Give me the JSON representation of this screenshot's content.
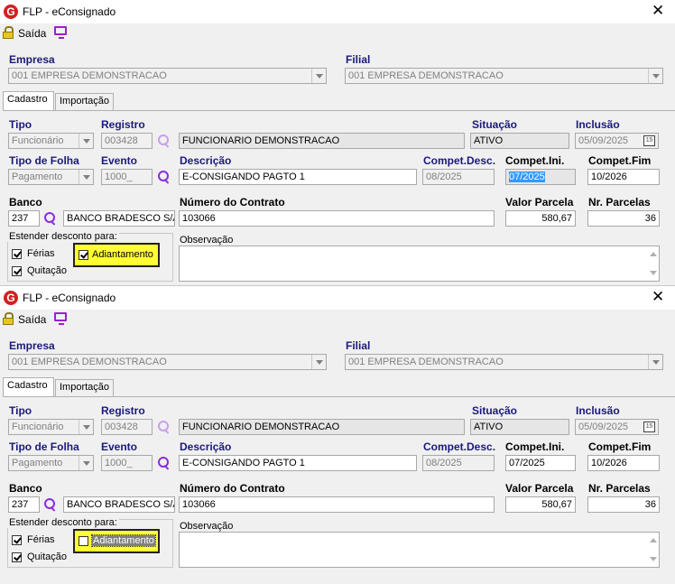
{
  "screens": [
    {
      "window_title": "FLP - eConsignado",
      "toolbar": {
        "exit_label": "Saída"
      },
      "empresa": {
        "label": "Empresa",
        "value": "001 EMPRESA DEMONSTRACAO"
      },
      "filial": {
        "label": "Filial",
        "value": "001 EMPRESA DEMONSTRACAO"
      },
      "tabs": [
        "Cadastro",
        "Importação"
      ],
      "tipo": {
        "label": "Tipo",
        "value": "Funcionário"
      },
      "registro": {
        "label": "Registro",
        "value": "003428",
        "name": "FUNCIONARIO DEMONSTRACAO"
      },
      "situacao": {
        "label": "Situação",
        "value": "ATIVO"
      },
      "inclusao": {
        "label": "Inclusão",
        "value": "05/09/2025",
        "calendar_day": "15"
      },
      "tipo_folha": {
        "label": "Tipo de Folha",
        "value": "Pagamento"
      },
      "evento": {
        "label": "Evento",
        "value": "1000_"
      },
      "descricao": {
        "label": "Descrição",
        "value": "E-CONSIGANDO PAGTO 1"
      },
      "compet_desc": {
        "label": "Compet.Desc.",
        "value": "08/2025"
      },
      "compet_ini": {
        "label": "Compet.Ini.",
        "value": "07/2025"
      },
      "compet_fim": {
        "label": "Compet.Fim",
        "value": "10/2026"
      },
      "banco": {
        "label": "Banco",
        "code": "237",
        "name": "BANCO BRADESCO S/A"
      },
      "contrato": {
        "label": "Número do Contrato",
        "value": "103066"
      },
      "valor_parcela": {
        "label": "Valor Parcela",
        "value": "580,67"
      },
      "nr_parcelas": {
        "label": "Nr. Parcelas",
        "value": "36"
      },
      "estender": {
        "title": "Estender desconto para:",
        "ferias": "Férias",
        "quitacao": "Quitação",
        "adiantamento": "Adiantamento",
        "ferias_checked": true,
        "quitacao_checked": true,
        "adiantamento_checked": true
      },
      "observacao": {
        "label": "Observação"
      }
    },
    {
      "window_title": "FLP - eConsignado",
      "toolbar": {
        "exit_label": "Saída"
      },
      "empresa": {
        "label": "Empresa",
        "value": "001 EMPRESA DEMONSTRACAO"
      },
      "filial": {
        "label": "Filial",
        "value": "001 EMPRESA DEMONSTRACAO"
      },
      "tabs": [
        "Cadastro",
        "Importação"
      ],
      "tipo": {
        "label": "Tipo",
        "value": "Funcionário"
      },
      "registro": {
        "label": "Registro",
        "value": "003428",
        "name": "FUNCIONARIO DEMONSTRACAO"
      },
      "situacao": {
        "label": "Situação",
        "value": "ATIVO"
      },
      "inclusao": {
        "label": "Inclusão",
        "value": "05/09/2025",
        "calendar_day": "15"
      },
      "tipo_folha": {
        "label": "Tipo de Folha",
        "value": "Pagamento"
      },
      "evento": {
        "label": "Evento",
        "value": "1000_"
      },
      "descricao": {
        "label": "Descrição",
        "value": "E-CONSIGANDO PAGTO 1"
      },
      "compet_desc": {
        "label": "Compet.Desc.",
        "value": "08/2025"
      },
      "compet_ini": {
        "label": "Compet.Ini.",
        "value": "07/2025"
      },
      "compet_fim": {
        "label": "Compet.Fim",
        "value": "10/2026"
      },
      "banco": {
        "label": "Banco",
        "code": "237",
        "name": "BANCO BRADESCO S/A"
      },
      "contrato": {
        "label": "Número do Contrato",
        "value": "103066"
      },
      "valor_parcela": {
        "label": "Valor Parcela",
        "value": "580,67"
      },
      "nr_parcelas": {
        "label": "Nr. Parcelas",
        "value": "36"
      },
      "estender": {
        "title": "Estender desconto para:",
        "ferias": "Férias",
        "quitacao": "Quitação",
        "adiantamento": "Adiantamento",
        "ferias_checked": true,
        "quitacao_checked": true,
        "adiantamento_checked": false
      },
      "observacao": {
        "label": "Observação"
      }
    }
  ],
  "colors": {
    "label": "#1a1a7a",
    "search_icon": "#8a2be2",
    "highlight": "#ffff33",
    "selection": "#3399ff",
    "app_icon": "#d42020"
  },
  "icons": {
    "app": "flp-logo-icon",
    "exit": "padlock-icon",
    "monitor": "monitor-icon",
    "search": "magnifier-icon",
    "calendar": "calendar-icon",
    "close": "close-icon"
  }
}
